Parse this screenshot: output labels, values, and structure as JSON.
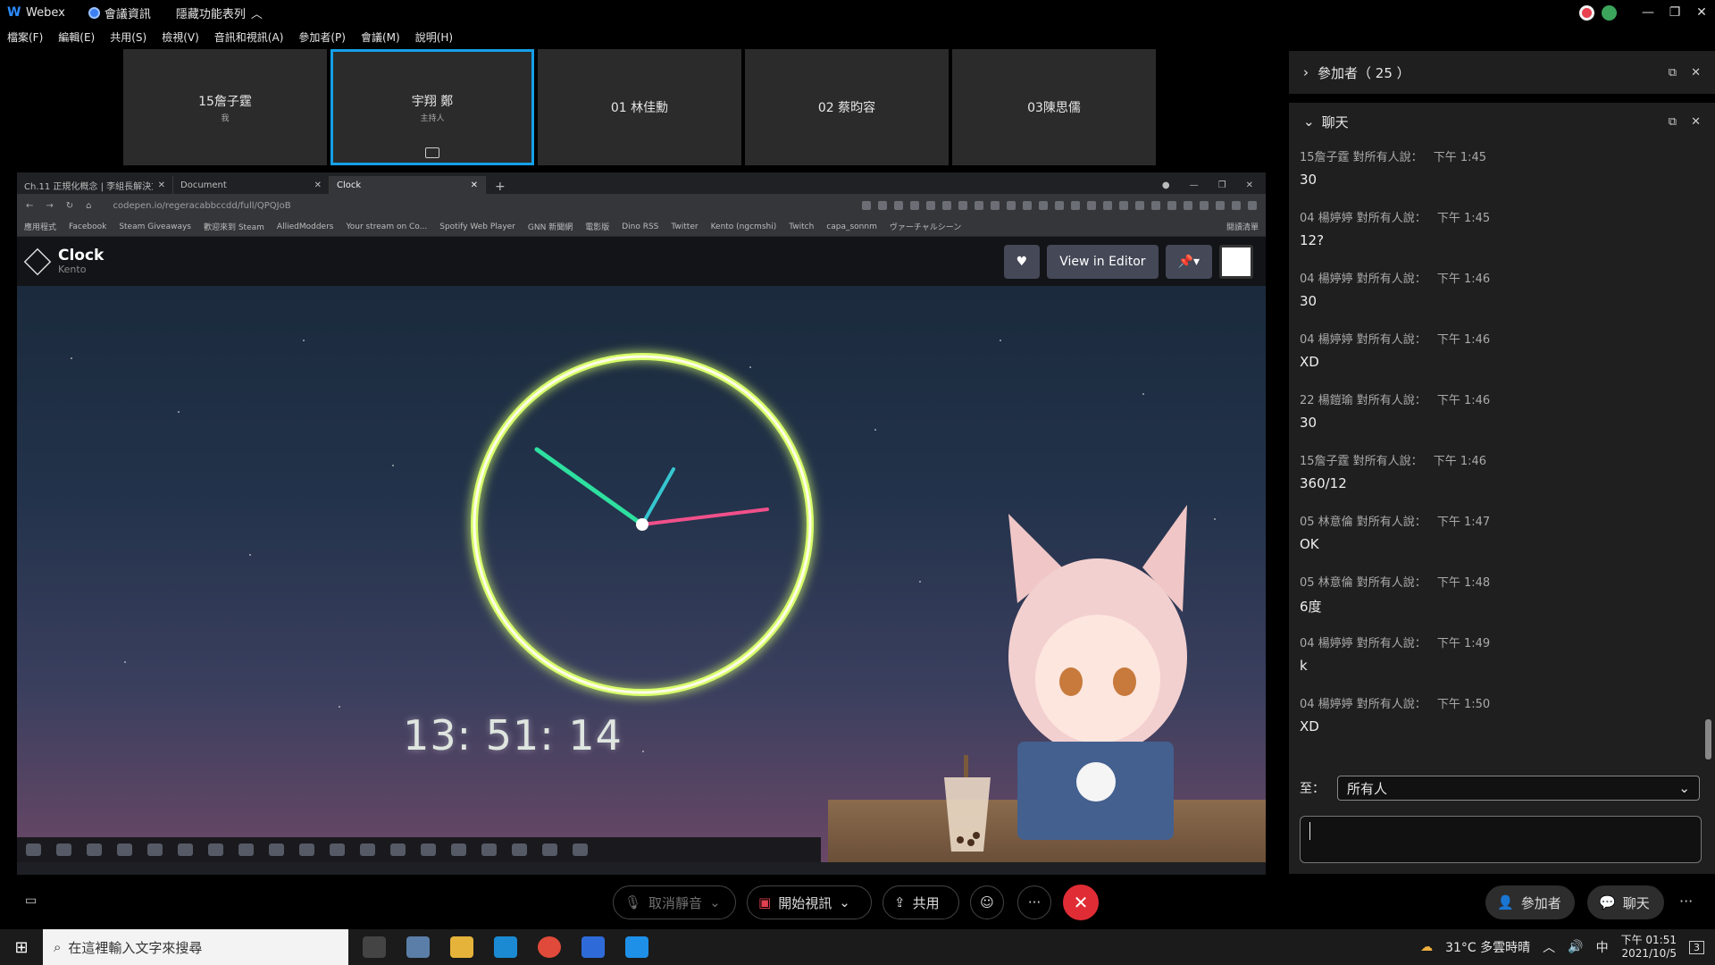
{
  "titlebar": {
    "app_name": "Webex",
    "meeting_info": "會議資訊",
    "hide_menu": "隱藏功能表列",
    "win_min": "—",
    "win_restore": "❐",
    "win_close": "✕"
  },
  "menu": [
    "檔案(F)",
    "編輯(E)",
    "共用(S)",
    "檢視(V)",
    "音訊和視訊(A)",
    "參加者(P)",
    "會議(M)",
    "說明(H)"
  ],
  "tiles": [
    {
      "name": "15詹子霆",
      "sub": "我"
    },
    {
      "name": "宇翔 鄭",
      "sub": "主持人"
    },
    {
      "name": "01 林佳勳",
      "sub": ""
    },
    {
      "name": "02 蔡昀容",
      "sub": ""
    },
    {
      "name": "03陳思儒",
      "sub": ""
    }
  ],
  "browser": {
    "tabs": [
      "Ch.11 正規化概念 | 李組長解決方案",
      "Document",
      "Clock"
    ],
    "url": "codepen.io/regeracabbccdd/full/QPQJoB",
    "bookmarks": [
      "應用程式",
      "Facebook",
      "Steam Giveaways",
      "歡迎來到 Steam",
      "AlliedModders",
      "Your stream on Co...",
      "Spotify Web Player",
      "GNN 新聞網",
      "電影版",
      "Dino RSS",
      "Twitter",
      "Kento (ngcmshi)",
      "Twitch",
      "capa_sonnm",
      "ヴァーチャルシーン",
      "閱讀清單"
    ]
  },
  "codepen": {
    "title": "Clock",
    "author": "Kento",
    "view_editor": "View in Editor"
  },
  "clock": {
    "time": "13: 51: 14",
    "colors": {
      "ring": "#d8ff6a",
      "hour": "#2ee0a0",
      "minute": "#36c6d0",
      "second": "#f0508a"
    }
  },
  "participants_panel": {
    "title": "參加者",
    "count": "（ 25 ）"
  },
  "chat": {
    "title": "聊天",
    "messages": [
      {
        "sender": "15詹子霆 對所有人說：",
        "time": "下午 1:45",
        "text": "30"
      },
      {
        "sender": "04 楊婷婷 對所有人說：",
        "time": "下午 1:45",
        "text": "12?"
      },
      {
        "sender": "04 楊婷婷 對所有人說：",
        "time": "下午 1:46",
        "text": "30"
      },
      {
        "sender": "04 楊婷婷 對所有人說：",
        "time": "下午 1:46",
        "text": "XD"
      },
      {
        "sender": "22 楊鎧瑜 對所有人說：",
        "time": "下午 1:46",
        "text": "30"
      },
      {
        "sender": "15詹子霆 對所有人說：",
        "time": "下午 1:46",
        "text": "360/12"
      },
      {
        "sender": "05 林意倫 對所有人說：",
        "time": "下午 1:47",
        "text": "OK"
      },
      {
        "sender": "05 林意倫 對所有人說：",
        "time": "下午 1:48",
        "text": "6度"
      },
      {
        "sender": "04 楊婷婷 對所有人說：",
        "time": "下午 1:49",
        "text": "k"
      },
      {
        "sender": "04 楊婷婷 對所有人說：",
        "time": "下午 1:50",
        "text": "XD"
      }
    ],
    "to_label": "至：",
    "to_value": "所有人"
  },
  "controls": {
    "unmute": "取消靜音",
    "start_video": "開始視訊",
    "share": "共用",
    "more": "···",
    "end": "✕",
    "participants": "參加者",
    "chat": "聊天"
  },
  "taskbar": {
    "search_placeholder": "在這裡輸入文字來搜尋",
    "weather": "31°C 多雲時晴",
    "lang": "中",
    "time": "下午 01:51",
    "date": "2021/10/5",
    "notifications": "3"
  }
}
